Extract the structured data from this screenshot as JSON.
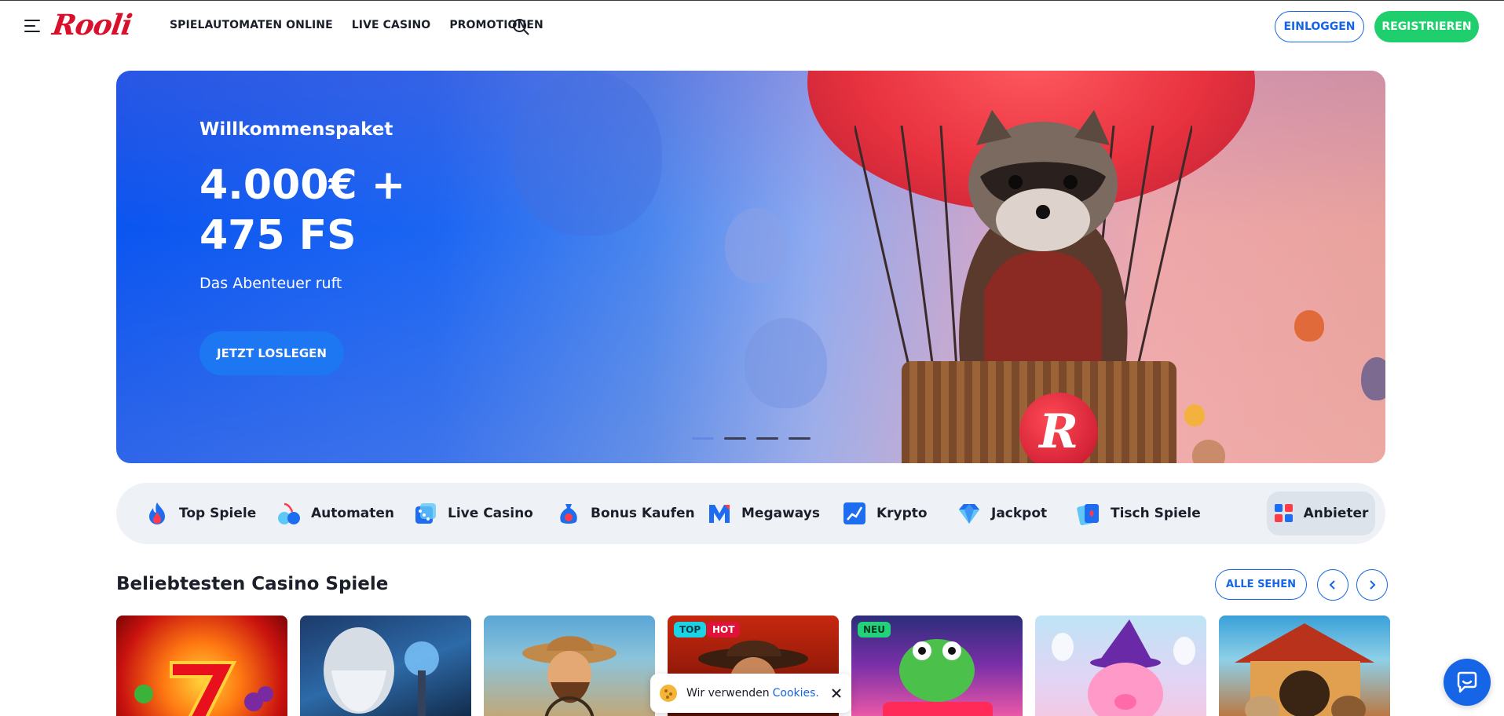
{
  "header": {
    "logo_text": "Rooli",
    "nav": [
      "SPIELAUTOMATEN ONLINE",
      "LIVE CASINO",
      "PROMOTIONEN"
    ],
    "login_label": "EINLOGGEN",
    "register_label": "REGISTRIEREN"
  },
  "hero": {
    "eyebrow": "Willkommenspaket",
    "title": "4.000€ + 475 FS",
    "subtitle": "Das Abenteuer ruft",
    "cta": "JETZT LOSLEGEN",
    "badge_letter": "R",
    "slides": 4,
    "active_slide": 1
  },
  "categories": [
    {
      "label": "Top Spiele",
      "icon": "flame-icon"
    },
    {
      "label": "Automaten",
      "icon": "cherries-icon"
    },
    {
      "label": "Live Casino",
      "icon": "dice-icon"
    },
    {
      "label": "Bonus Kaufen",
      "icon": "money-bag-icon"
    },
    {
      "label": "Megaways",
      "icon": "megaways-icon"
    },
    {
      "label": "Krypto",
      "icon": "chart-icon"
    },
    {
      "label": "Jackpot",
      "icon": "diamond-icon"
    },
    {
      "label": "Tisch Spiele",
      "icon": "cards-icon"
    }
  ],
  "providers_label": "Anbieter",
  "section": {
    "title": "Beliebtesten Casino Spiele",
    "see_all": "ALLE SEHEN"
  },
  "games": [
    {
      "badges": []
    },
    {
      "badges": []
    },
    {
      "badges": []
    },
    {
      "badges": [
        "TOP",
        "HOT"
      ]
    },
    {
      "badges": [
        "NEU"
      ]
    },
    {
      "badges": []
    },
    {
      "badges": []
    }
  ],
  "cookie": {
    "text": "Wir verwenden",
    "link": "Cookies."
  },
  "colors": {
    "brand_red": "#d8102b",
    "accent_blue": "#1565e6",
    "register_green": "#1fcf6e"
  }
}
